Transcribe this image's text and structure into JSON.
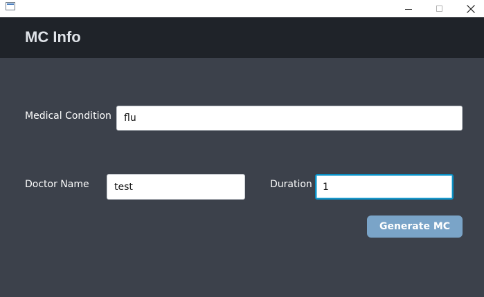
{
  "window": {
    "controls": {
      "minimize_icon": "minimize-icon",
      "maximize_icon": "maximize-icon",
      "close_icon": "close-icon"
    }
  },
  "header": {
    "title": "MC Info"
  },
  "form": {
    "medical_condition": {
      "label": "Medical Condition",
      "value": "flu"
    },
    "doctor_name": {
      "label": "Doctor Name",
      "value": "test"
    },
    "duration": {
      "label": "Duration",
      "value": "1"
    },
    "generate_button": {
      "label": "Generate MC"
    }
  },
  "colors": {
    "background": "#3c414b",
    "header": "#1f2329",
    "button": "#7aa4c8",
    "focus_border": "#0a8fc4"
  }
}
